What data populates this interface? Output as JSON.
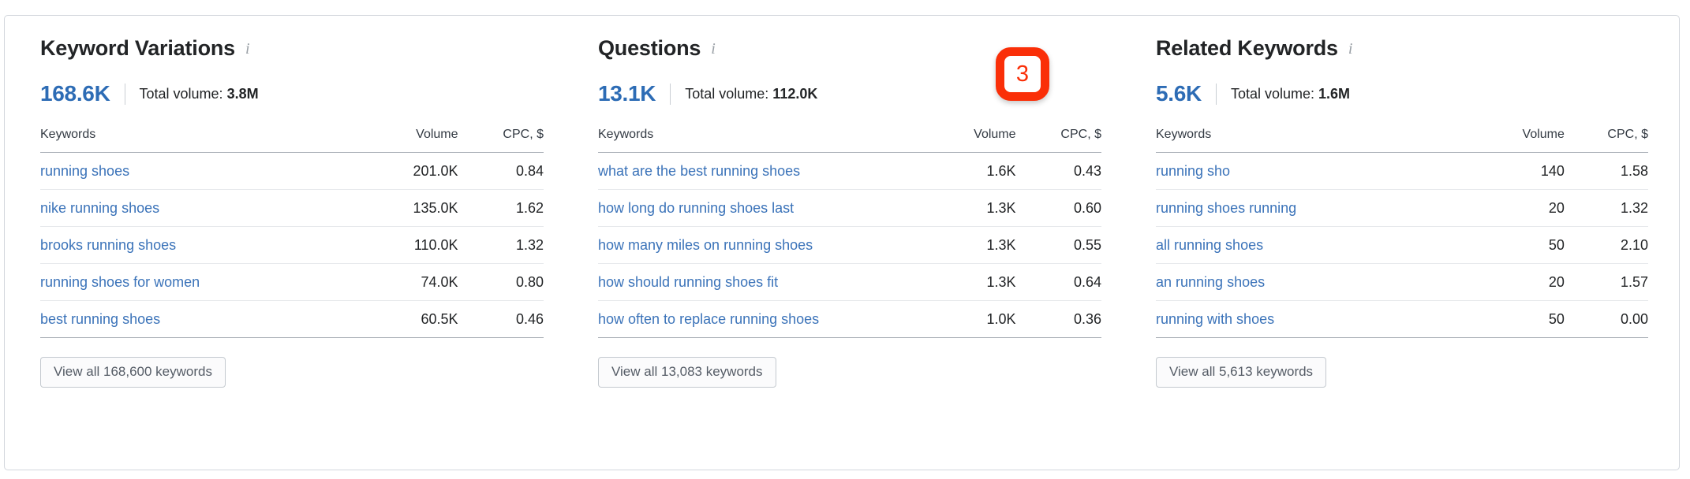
{
  "card": {
    "annotation_badge": {
      "label": "3",
      "color": "#fa2f08"
    },
    "columns": [
      {
        "title": "Keyword Variations",
        "info_icon": "info-icon",
        "count": "168.6K",
        "total_volume_label": "Total volume:",
        "total_volume_value": "3.8M",
        "table": {
          "headers": [
            "Keywords",
            "Volume",
            "CPC, $"
          ],
          "rows": [
            {
              "keyword": "running shoes",
              "volume": "201.0K",
              "cpc": "0.84"
            },
            {
              "keyword": "nike running shoes",
              "volume": "135.0K",
              "cpc": "1.62"
            },
            {
              "keyword": "brooks running shoes",
              "volume": "110.0K",
              "cpc": "1.32"
            },
            {
              "keyword": "running shoes for women",
              "volume": "74.0K",
              "cpc": "0.80"
            },
            {
              "keyword": "best running shoes",
              "volume": "60.5K",
              "cpc": "0.46"
            }
          ]
        },
        "view_all_label": "View all 168,600 keywords"
      },
      {
        "title": "Questions",
        "info_icon": "info-icon",
        "count": "13.1K",
        "total_volume_label": "Total volume:",
        "total_volume_value": "112.0K",
        "table": {
          "headers": [
            "Keywords",
            "Volume",
            "CPC, $"
          ],
          "rows": [
            {
              "keyword": "what are the best running shoes",
              "volume": "1.6K",
              "cpc": "0.43"
            },
            {
              "keyword": "how long do running shoes last",
              "volume": "1.3K",
              "cpc": "0.60"
            },
            {
              "keyword": "how many miles on running shoes",
              "volume": "1.3K",
              "cpc": "0.55"
            },
            {
              "keyword": "how should running shoes fit",
              "volume": "1.3K",
              "cpc": "0.64"
            },
            {
              "keyword": "how often to replace running shoes",
              "volume": "1.0K",
              "cpc": "0.36"
            }
          ]
        },
        "view_all_label": "View all 13,083 keywords"
      },
      {
        "title": "Related Keywords",
        "info_icon": "info-icon",
        "count": "5.6K",
        "total_volume_label": "Total volume:",
        "total_volume_value": "1.6M",
        "table": {
          "headers": [
            "Keywords",
            "Volume",
            "CPC, $"
          ],
          "rows": [
            {
              "keyword": "running sho",
              "volume": "140",
              "cpc": "1.58"
            },
            {
              "keyword": "running shoes running",
              "volume": "20",
              "cpc": "1.32"
            },
            {
              "keyword": "all running shoes",
              "volume": "50",
              "cpc": "2.10"
            },
            {
              "keyword": "an running shoes",
              "volume": "20",
              "cpc": "1.57"
            },
            {
              "keyword": "running with shoes",
              "volume": "50",
              "cpc": "0.00"
            }
          ]
        },
        "view_all_label": "View all 5,613 keywords"
      }
    ]
  },
  "theme": {
    "link_color": "#3b73b9",
    "accent_blue": "#2d6cb5",
    "text_color": "#222426",
    "border_color": "#d2d6dc"
  }
}
